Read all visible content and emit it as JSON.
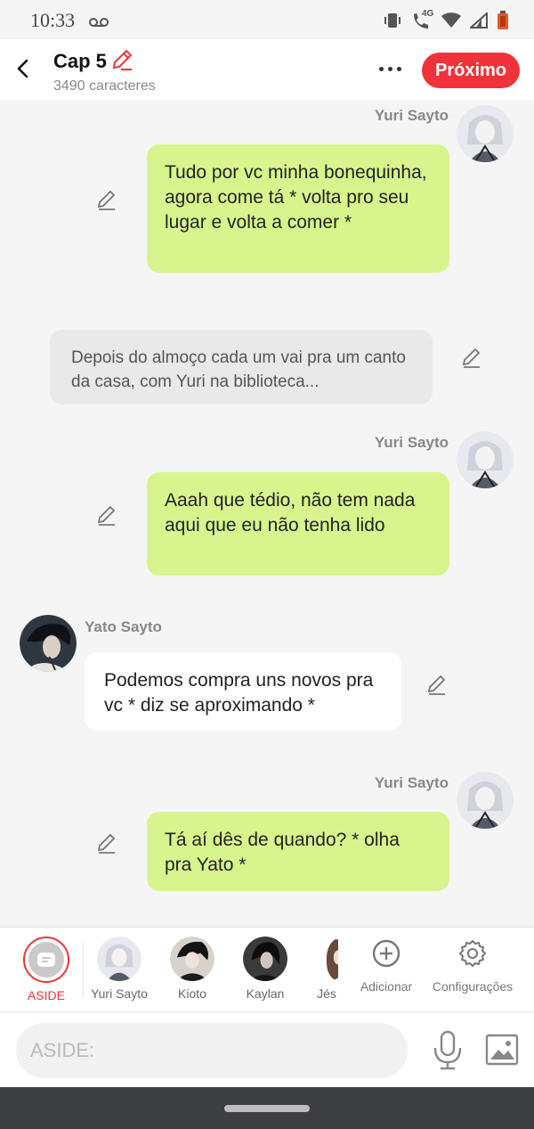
{
  "status_bar": {
    "time": "10:33",
    "network": "4G"
  },
  "header": {
    "chapter_title": "Cap 5",
    "char_count": "3490 caracteres",
    "next_label": "Próximo"
  },
  "messages": [
    {
      "type": "right",
      "speaker": "Yuri Sayto",
      "text": "Tudo por vc minha bonequinha, agora come tá * volta pro seu lugar e volta a comer *"
    },
    {
      "type": "narration",
      "text": "Depois do almoço cada um vai pra um canto da casa, com Yuri na biblioteca..."
    },
    {
      "type": "right",
      "speaker": "Yuri Sayto",
      "text": "Aaah que tédio, não tem nada aqui que eu não tenha lido"
    },
    {
      "type": "left",
      "speaker": "Yato Sayto",
      "text": "Podemos compra uns novos pra vc * diz se aproximando *"
    },
    {
      "type": "right",
      "speaker": "Yuri Sayto",
      "text": "Tá aí dês de quando? * olha pra Yato *"
    }
  ],
  "char_bar": {
    "aside_label": "ASIDE",
    "characters": [
      "Yuri Sayto",
      "Kioto",
      "Kaylan",
      "Jés"
    ],
    "add_label": "Adicionar",
    "settings_label": "Configurações"
  },
  "input": {
    "placeholder": "ASIDE:"
  },
  "colors": {
    "accent": "#f0333a",
    "bubble_right": "#d7f58c",
    "bubble_narration": "#e9e9e9"
  }
}
